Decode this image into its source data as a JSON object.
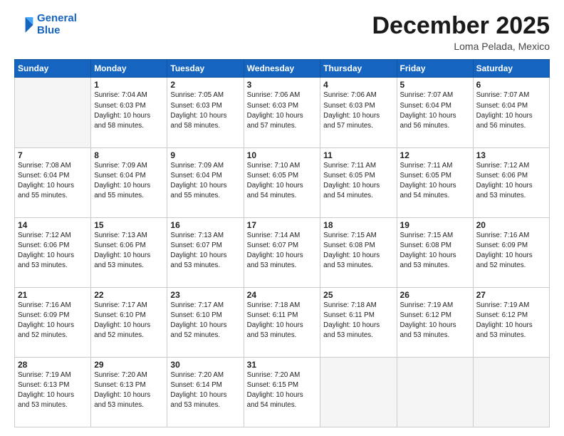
{
  "header": {
    "logo_line1": "General",
    "logo_line2": "Blue",
    "month": "December 2025",
    "location": "Loma Pelada, Mexico"
  },
  "weekdays": [
    "Sunday",
    "Monday",
    "Tuesday",
    "Wednesday",
    "Thursday",
    "Friday",
    "Saturday"
  ],
  "weeks": [
    [
      {
        "day": "",
        "info": ""
      },
      {
        "day": "1",
        "info": "Sunrise: 7:04 AM\nSunset: 6:03 PM\nDaylight: 10 hours\nand 58 minutes."
      },
      {
        "day": "2",
        "info": "Sunrise: 7:05 AM\nSunset: 6:03 PM\nDaylight: 10 hours\nand 58 minutes."
      },
      {
        "day": "3",
        "info": "Sunrise: 7:06 AM\nSunset: 6:03 PM\nDaylight: 10 hours\nand 57 minutes."
      },
      {
        "day": "4",
        "info": "Sunrise: 7:06 AM\nSunset: 6:03 PM\nDaylight: 10 hours\nand 57 minutes."
      },
      {
        "day": "5",
        "info": "Sunrise: 7:07 AM\nSunset: 6:04 PM\nDaylight: 10 hours\nand 56 minutes."
      },
      {
        "day": "6",
        "info": "Sunrise: 7:07 AM\nSunset: 6:04 PM\nDaylight: 10 hours\nand 56 minutes."
      }
    ],
    [
      {
        "day": "7",
        "info": "Sunrise: 7:08 AM\nSunset: 6:04 PM\nDaylight: 10 hours\nand 55 minutes."
      },
      {
        "day": "8",
        "info": "Sunrise: 7:09 AM\nSunset: 6:04 PM\nDaylight: 10 hours\nand 55 minutes."
      },
      {
        "day": "9",
        "info": "Sunrise: 7:09 AM\nSunset: 6:04 PM\nDaylight: 10 hours\nand 55 minutes."
      },
      {
        "day": "10",
        "info": "Sunrise: 7:10 AM\nSunset: 6:05 PM\nDaylight: 10 hours\nand 54 minutes."
      },
      {
        "day": "11",
        "info": "Sunrise: 7:11 AM\nSunset: 6:05 PM\nDaylight: 10 hours\nand 54 minutes."
      },
      {
        "day": "12",
        "info": "Sunrise: 7:11 AM\nSunset: 6:05 PM\nDaylight: 10 hours\nand 54 minutes."
      },
      {
        "day": "13",
        "info": "Sunrise: 7:12 AM\nSunset: 6:06 PM\nDaylight: 10 hours\nand 53 minutes."
      }
    ],
    [
      {
        "day": "14",
        "info": "Sunrise: 7:12 AM\nSunset: 6:06 PM\nDaylight: 10 hours\nand 53 minutes."
      },
      {
        "day": "15",
        "info": "Sunrise: 7:13 AM\nSunset: 6:06 PM\nDaylight: 10 hours\nand 53 minutes."
      },
      {
        "day": "16",
        "info": "Sunrise: 7:13 AM\nSunset: 6:07 PM\nDaylight: 10 hours\nand 53 minutes."
      },
      {
        "day": "17",
        "info": "Sunrise: 7:14 AM\nSunset: 6:07 PM\nDaylight: 10 hours\nand 53 minutes."
      },
      {
        "day": "18",
        "info": "Sunrise: 7:15 AM\nSunset: 6:08 PM\nDaylight: 10 hours\nand 53 minutes."
      },
      {
        "day": "19",
        "info": "Sunrise: 7:15 AM\nSunset: 6:08 PM\nDaylight: 10 hours\nand 53 minutes."
      },
      {
        "day": "20",
        "info": "Sunrise: 7:16 AM\nSunset: 6:09 PM\nDaylight: 10 hours\nand 52 minutes."
      }
    ],
    [
      {
        "day": "21",
        "info": "Sunrise: 7:16 AM\nSunset: 6:09 PM\nDaylight: 10 hours\nand 52 minutes."
      },
      {
        "day": "22",
        "info": "Sunrise: 7:17 AM\nSunset: 6:10 PM\nDaylight: 10 hours\nand 52 minutes."
      },
      {
        "day": "23",
        "info": "Sunrise: 7:17 AM\nSunset: 6:10 PM\nDaylight: 10 hours\nand 52 minutes."
      },
      {
        "day": "24",
        "info": "Sunrise: 7:18 AM\nSunset: 6:11 PM\nDaylight: 10 hours\nand 53 minutes."
      },
      {
        "day": "25",
        "info": "Sunrise: 7:18 AM\nSunset: 6:11 PM\nDaylight: 10 hours\nand 53 minutes."
      },
      {
        "day": "26",
        "info": "Sunrise: 7:19 AM\nSunset: 6:12 PM\nDaylight: 10 hours\nand 53 minutes."
      },
      {
        "day": "27",
        "info": "Sunrise: 7:19 AM\nSunset: 6:12 PM\nDaylight: 10 hours\nand 53 minutes."
      }
    ],
    [
      {
        "day": "28",
        "info": "Sunrise: 7:19 AM\nSunset: 6:13 PM\nDaylight: 10 hours\nand 53 minutes."
      },
      {
        "day": "29",
        "info": "Sunrise: 7:20 AM\nSunset: 6:13 PM\nDaylight: 10 hours\nand 53 minutes."
      },
      {
        "day": "30",
        "info": "Sunrise: 7:20 AM\nSunset: 6:14 PM\nDaylight: 10 hours\nand 53 minutes."
      },
      {
        "day": "31",
        "info": "Sunrise: 7:20 AM\nSunset: 6:15 PM\nDaylight: 10 hours\nand 54 minutes."
      },
      {
        "day": "",
        "info": ""
      },
      {
        "day": "",
        "info": ""
      },
      {
        "day": "",
        "info": ""
      }
    ]
  ]
}
